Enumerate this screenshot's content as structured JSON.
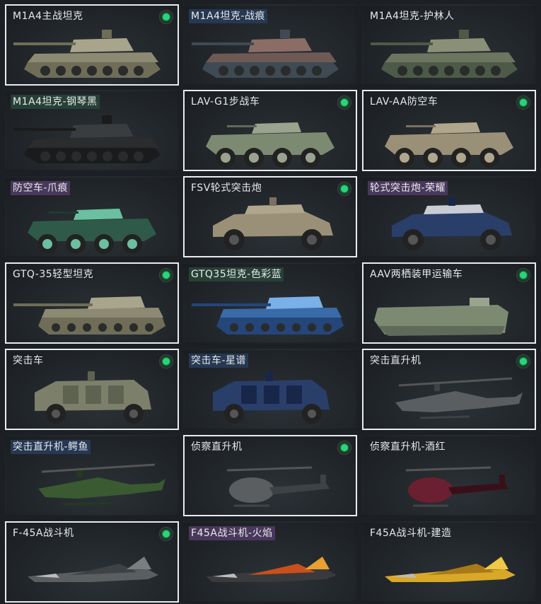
{
  "vehicles": [
    {
      "name": "M1A4主战坦克",
      "owned": true,
      "type": "tank",
      "camo": "desert",
      "tag": "none"
    },
    {
      "name": "M1A4坦克-战痕",
      "owned": false,
      "type": "tank",
      "camo": "scar",
      "tag": "blue"
    },
    {
      "name": "M1A4坦克-护林人",
      "owned": false,
      "type": "tank",
      "camo": "forest",
      "tag": "none"
    },
    {
      "name": "M1A4坦克-钢琴黑",
      "owned": false,
      "type": "tank",
      "camo": "black",
      "tag": "green"
    },
    {
      "name": "LAV-G1步战车",
      "owned": true,
      "type": "lav",
      "camo": "green",
      "tag": "none"
    },
    {
      "name": "LAV-AA防空车",
      "owned": true,
      "type": "lav",
      "camo": "tan",
      "tag": "none"
    },
    {
      "name": "防空车-爪痕",
      "owned": false,
      "type": "lav",
      "camo": "claw",
      "tag": "purple"
    },
    {
      "name": "FSV轮式突击炮",
      "owned": true,
      "type": "fsv",
      "camo": "tan",
      "tag": "none"
    },
    {
      "name": "轮式突击炮-荣耀",
      "owned": false,
      "type": "fsv",
      "camo": "navy",
      "tag": "purple"
    },
    {
      "name": "GTQ-35轻型坦克",
      "owned": true,
      "type": "light",
      "camo": "desert",
      "tag": "none"
    },
    {
      "name": "GTQ35坦克-色彩蓝",
      "owned": false,
      "type": "light",
      "camo": "blue",
      "tag": "green"
    },
    {
      "name": "AAV两栖装甲运输车",
      "owned": true,
      "type": "aav",
      "camo": "green",
      "tag": "none"
    },
    {
      "name": "突击车",
      "owned": true,
      "type": "truck",
      "camo": "olive",
      "tag": "none"
    },
    {
      "name": "突击车-星谱",
      "owned": false,
      "type": "truck",
      "camo": "navy",
      "tag": "blue"
    },
    {
      "name": "突击直升机",
      "owned": true,
      "type": "heli",
      "camo": "gray",
      "tag": "none"
    },
    {
      "name": "突击直升机-鳄鱼",
      "owned": false,
      "type": "heli",
      "camo": "croc",
      "tag": "blue"
    },
    {
      "name": "侦察直升机",
      "owned": true,
      "type": "scout",
      "camo": "gray",
      "tag": "none"
    },
    {
      "name": "侦察直升机-酒红",
      "owned": false,
      "type": "scout",
      "camo": "wine",
      "tag": "none"
    },
    {
      "name": "F-45A战斗机",
      "owned": true,
      "type": "jet",
      "camo": "gray",
      "tag": "none"
    },
    {
      "name": "F45A战斗机-火焰",
      "owned": false,
      "type": "jet",
      "camo": "flame",
      "tag": "purple"
    },
    {
      "name": "F45A战斗机-建造",
      "owned": false,
      "type": "jet",
      "camo": "yellow",
      "tag": "none"
    }
  ],
  "colors": {
    "owned_dot": "#27d67a",
    "owned_border": "#e9ecee",
    "background": "#1c2024"
  }
}
